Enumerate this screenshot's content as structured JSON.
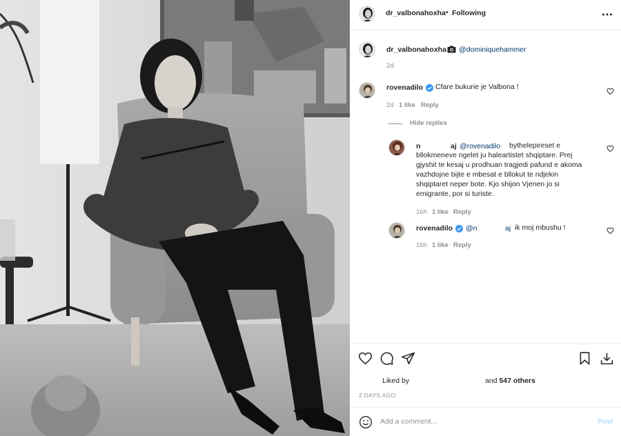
{
  "post": {
    "author": "dr_valbonahoxha",
    "follow_separator": "•",
    "follow_status": "Following",
    "caption": {
      "username": "dr_valbonahoxha",
      "icon": "camera-icon",
      "mention": "@dominiquehammer",
      "time": "2d"
    }
  },
  "comments": [
    {
      "username": "rovenadilo",
      "verified": true,
      "text": "Cfare bukurie je Valbona !",
      "time": "2d",
      "likes": "1 like",
      "reply": "Reply",
      "hide_replies": "Hide replies",
      "replies": [
        {
          "username_start": "n",
          "username_end": "aj",
          "mention": "@rovenadilo",
          "text_lines": [
            "bythelepireset e",
            "bllokmeneve ngelet ju haleartistet shqiptare. Prej",
            "gjyshit te kesaj u prodhuan tragjedi pafund e akoma",
            "vazhdojne bijte e mbesat e bllokut te ndjekin",
            "shqiptaret neper bote. Kjo shijon Vjenen jo si",
            "emigrante, por si turiste."
          ],
          "time": "16h",
          "likes": "1 like",
          "reply": "Reply"
        },
        {
          "username": "rovenadilo",
          "verified": true,
          "mention_start": "@n",
          "mention_end": "aj",
          "text": "ik moj mbushu !",
          "time": "16h",
          "likes": "1 like",
          "reply": "Reply"
        }
      ]
    }
  ],
  "actions": {
    "like_icon": "heart-icon",
    "comment_icon": "comment-icon",
    "share_icon": "paper-plane-icon",
    "save_icon": "bookmark-icon",
    "download_icon": "download-icon"
  },
  "likes": {
    "prefix": "Liked by",
    "suffix": "and",
    "count": "547 others"
  },
  "posted": "2 DAYS AGO",
  "composer": {
    "emoji_icon": "smiley-icon",
    "placeholder": "Add a comment...",
    "post_label": "Post"
  },
  "colors": {
    "link": "#00376b",
    "verified": "#3897f0",
    "post_disabled": "#b2dffc",
    "secondary_text": "#8e8e8e"
  }
}
